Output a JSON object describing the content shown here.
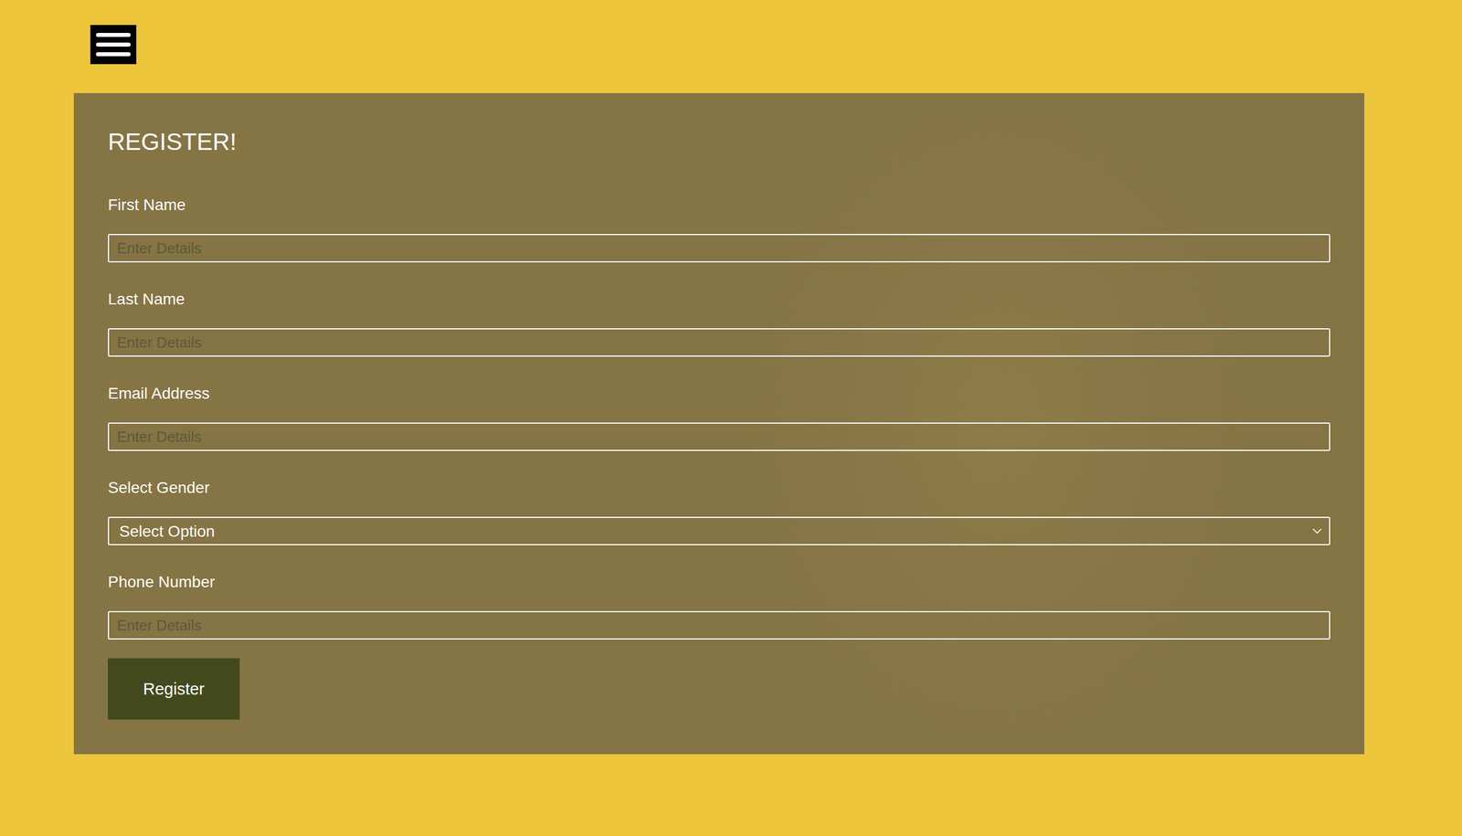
{
  "form": {
    "title": "REGISTER!",
    "fields": [
      {
        "label": "First Name",
        "kind": "input",
        "placeholder": "Enter Details"
      },
      {
        "label": "Last Name",
        "kind": "input",
        "placeholder": "Enter Details"
      },
      {
        "label": "Email Address",
        "kind": "input",
        "placeholder": "Enter Details"
      },
      {
        "label": "Select Gender",
        "kind": "select",
        "value": "Select Option"
      },
      {
        "label": "Phone Number",
        "kind": "input",
        "placeholder": "Enter Details"
      }
    ],
    "submit": "Register"
  }
}
